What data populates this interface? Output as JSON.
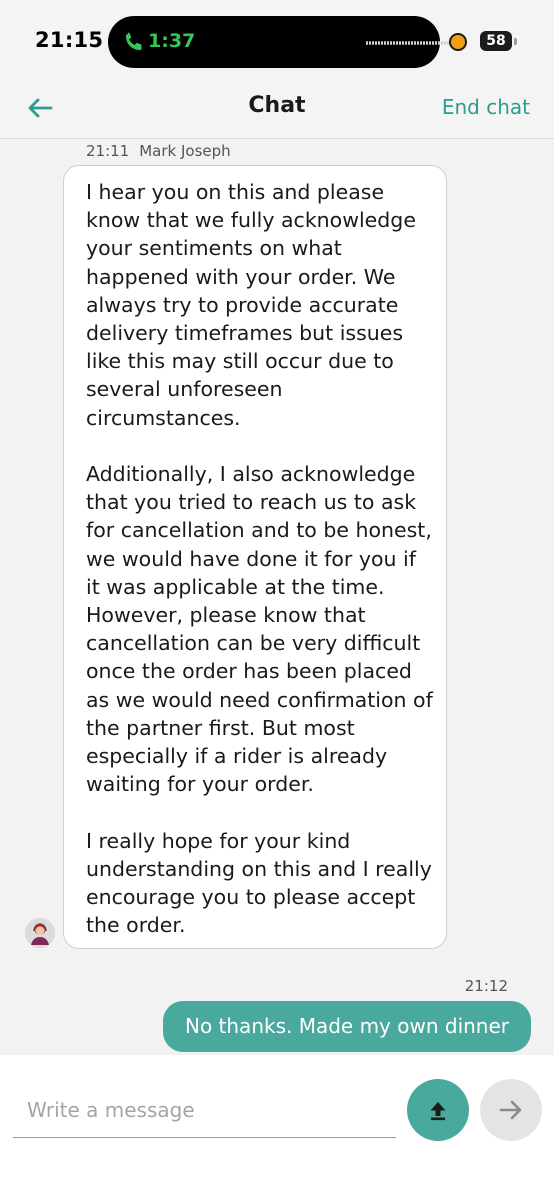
{
  "status_bar": {
    "time": "21:15",
    "call_timer": "1:37",
    "battery_level": "58",
    "call_icon": "phone-icon",
    "accent_green": "#34c759",
    "mic_indicator_color": "#f39c12"
  },
  "header": {
    "title": "Chat",
    "end_chat_label": "End chat",
    "back_icon": "arrow-left-icon",
    "accent": "#2a9d8f"
  },
  "messages": [
    {
      "direction": "incoming",
      "time": "21:11",
      "sender": "Mark Joseph",
      "paragraphs": [
        "I hear you on this and please know that we fully acknowledge your sentiments on what happened with your order. We always try to provide accurate delivery timeframes but issues like this may still occur due to several unforeseen circumstances.",
        "Additionally, I also acknowledge that you tried to reach us to ask for cancellation and to be honest, we would have done it for you if it was applicable at the time. However, please know that cancellation can be very difficult once the order has been placed as we would need confirmation of the partner first. But most especially if a rider is already waiting for your order.",
        "I really hope for your kind understanding on this and I really encourage you to please accept the order."
      ],
      "avatar_icon": "agent-avatar-icon"
    },
    {
      "direction": "outgoing",
      "time": "21:12",
      "text": "No thanks. Made my own dinner",
      "bubble_color": "#4aa99d"
    }
  ],
  "composer": {
    "placeholder": "Write a message",
    "value": "",
    "attach_icon": "upload-icon",
    "send_icon": "arrow-right-icon"
  }
}
